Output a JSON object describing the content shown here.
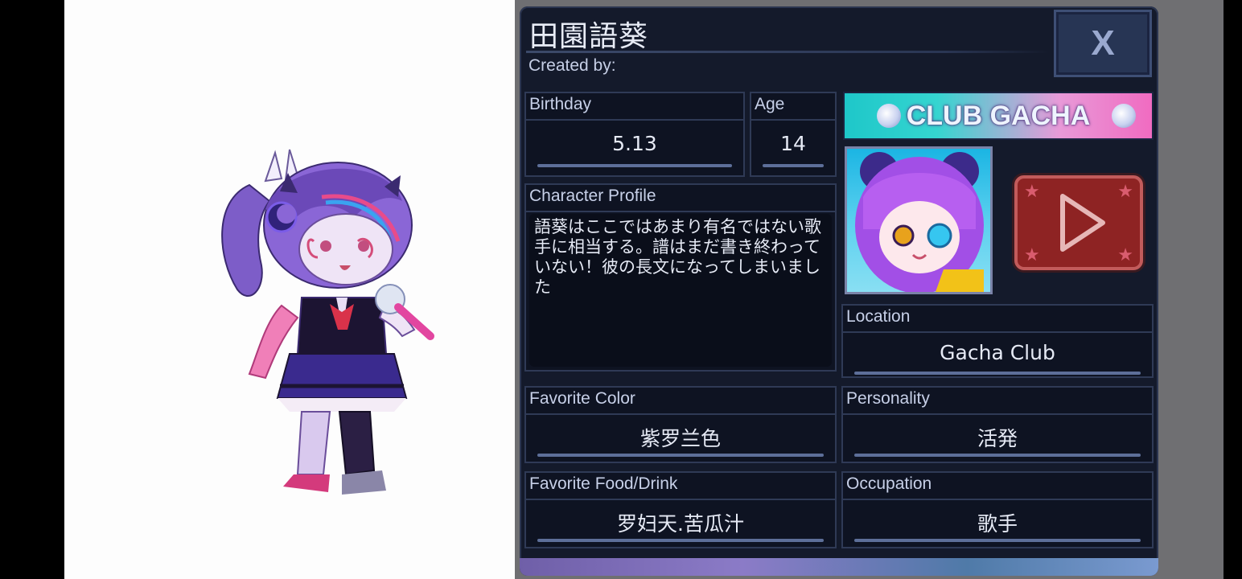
{
  "character": {
    "name": "田園語葵",
    "created_by_label": "Created by:",
    "close_label": "X"
  },
  "fields": {
    "birthday": {
      "label": "Birthday",
      "value": "5.13"
    },
    "age": {
      "label": "Age",
      "value": "14"
    },
    "profile": {
      "label": "Character Profile",
      "value": "語葵はここではあまり有名ではない歌手に相当する。譜はまだ書き終わっていない！彼の長文になってしまいました"
    },
    "location": {
      "label": "Location",
      "value": "Gacha Club"
    },
    "favorite_color": {
      "label": "Favorite Color",
      "value": "紫罗兰色"
    },
    "personality": {
      "label": "Personality",
      "value": "活発"
    },
    "favorite_food": {
      "label": "Favorite Food/Drink",
      "value": "罗妇天.苦瓜汁"
    },
    "occupation": {
      "label": "Occupation",
      "value": "歌手"
    }
  },
  "banner": {
    "text": "CLUB GACHA"
  },
  "colors": {
    "panel": "#141a2b",
    "accent": "#5d6f99",
    "play": "#8e2323"
  }
}
